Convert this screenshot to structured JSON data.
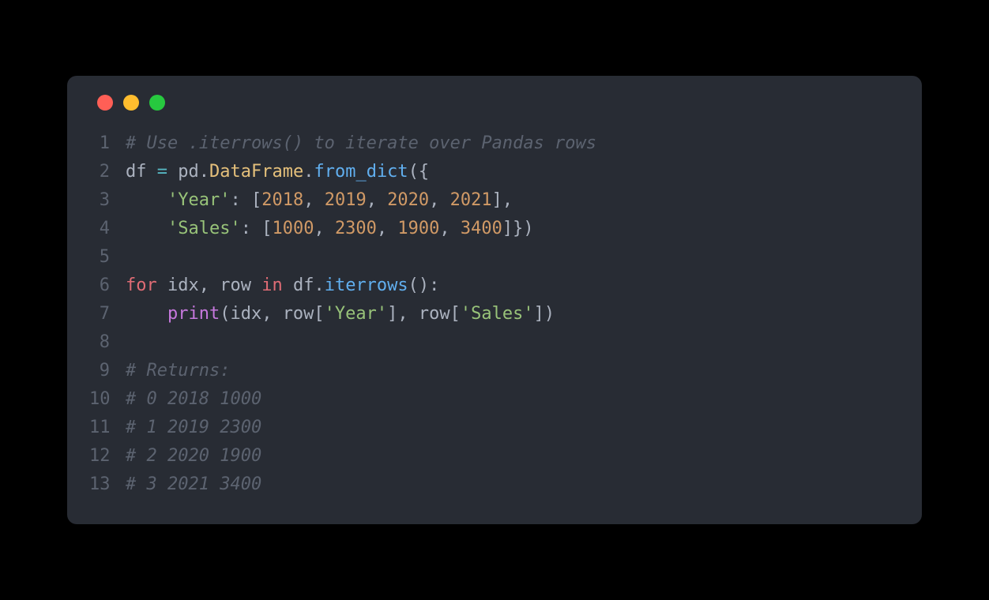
{
  "trafficLights": [
    "red",
    "yellow",
    "green"
  ],
  "lines": [
    {
      "num": "1",
      "tokens": [
        {
          "cls": "tk-comment",
          "text": "# Use .iterrows() to iterate over Pandas rows"
        }
      ]
    },
    {
      "num": "2",
      "tokens": [
        {
          "cls": "tk-variable",
          "text": "df "
        },
        {
          "cls": "tk-operator",
          "text": "="
        },
        {
          "cls": "tk-variable",
          "text": " pd"
        },
        {
          "cls": "tk-punct",
          "text": "."
        },
        {
          "cls": "tk-object",
          "text": "DataFrame"
        },
        {
          "cls": "tk-punct",
          "text": "."
        },
        {
          "cls": "tk-method",
          "text": "from_dict"
        },
        {
          "cls": "tk-punct",
          "text": "({"
        }
      ]
    },
    {
      "num": "3",
      "tokens": [
        {
          "cls": "tk-variable",
          "text": "    "
        },
        {
          "cls": "tk-string",
          "text": "'Year'"
        },
        {
          "cls": "tk-punct",
          "text": ": ["
        },
        {
          "cls": "tk-number",
          "text": "2018"
        },
        {
          "cls": "tk-punct",
          "text": ", "
        },
        {
          "cls": "tk-number",
          "text": "2019"
        },
        {
          "cls": "tk-punct",
          "text": ", "
        },
        {
          "cls": "tk-number",
          "text": "2020"
        },
        {
          "cls": "tk-punct",
          "text": ", "
        },
        {
          "cls": "tk-number",
          "text": "2021"
        },
        {
          "cls": "tk-punct",
          "text": "],"
        }
      ]
    },
    {
      "num": "4",
      "tokens": [
        {
          "cls": "tk-variable",
          "text": "    "
        },
        {
          "cls": "tk-string",
          "text": "'Sales'"
        },
        {
          "cls": "tk-punct",
          "text": ": ["
        },
        {
          "cls": "tk-number",
          "text": "1000"
        },
        {
          "cls": "tk-punct",
          "text": ", "
        },
        {
          "cls": "tk-number",
          "text": "2300"
        },
        {
          "cls": "tk-punct",
          "text": ", "
        },
        {
          "cls": "tk-number",
          "text": "1900"
        },
        {
          "cls": "tk-punct",
          "text": ", "
        },
        {
          "cls": "tk-number",
          "text": "3400"
        },
        {
          "cls": "tk-punct",
          "text": "]})"
        }
      ]
    },
    {
      "num": "5",
      "tokens": []
    },
    {
      "num": "6",
      "tokens": [
        {
          "cls": "tk-keyword-red",
          "text": "for"
        },
        {
          "cls": "tk-variable",
          "text": " idx, row "
        },
        {
          "cls": "tk-keyword-red",
          "text": "in"
        },
        {
          "cls": "tk-variable",
          "text": " df"
        },
        {
          "cls": "tk-punct",
          "text": "."
        },
        {
          "cls": "tk-method",
          "text": "iterrows"
        },
        {
          "cls": "tk-punct",
          "text": "():"
        }
      ]
    },
    {
      "num": "7",
      "tokens": [
        {
          "cls": "tk-variable",
          "text": "    "
        },
        {
          "cls": "tk-keyword",
          "text": "print"
        },
        {
          "cls": "tk-punct",
          "text": "(idx, row["
        },
        {
          "cls": "tk-string",
          "text": "'Year'"
        },
        {
          "cls": "tk-punct",
          "text": "], row["
        },
        {
          "cls": "tk-string",
          "text": "'Sales'"
        },
        {
          "cls": "tk-punct",
          "text": "])"
        }
      ]
    },
    {
      "num": "8",
      "tokens": []
    },
    {
      "num": "9",
      "tokens": [
        {
          "cls": "tk-comment",
          "text": "# Returns:"
        }
      ]
    },
    {
      "num": "10",
      "tokens": [
        {
          "cls": "tk-comment",
          "text": "# 0 2018 1000"
        }
      ]
    },
    {
      "num": "11",
      "tokens": [
        {
          "cls": "tk-comment",
          "text": "# 1 2019 2300"
        }
      ]
    },
    {
      "num": "12",
      "tokens": [
        {
          "cls": "tk-comment",
          "text": "# 2 2020 1900"
        }
      ]
    },
    {
      "num": "13",
      "tokens": [
        {
          "cls": "tk-comment",
          "text": "# 3 2021 3400"
        }
      ]
    }
  ]
}
